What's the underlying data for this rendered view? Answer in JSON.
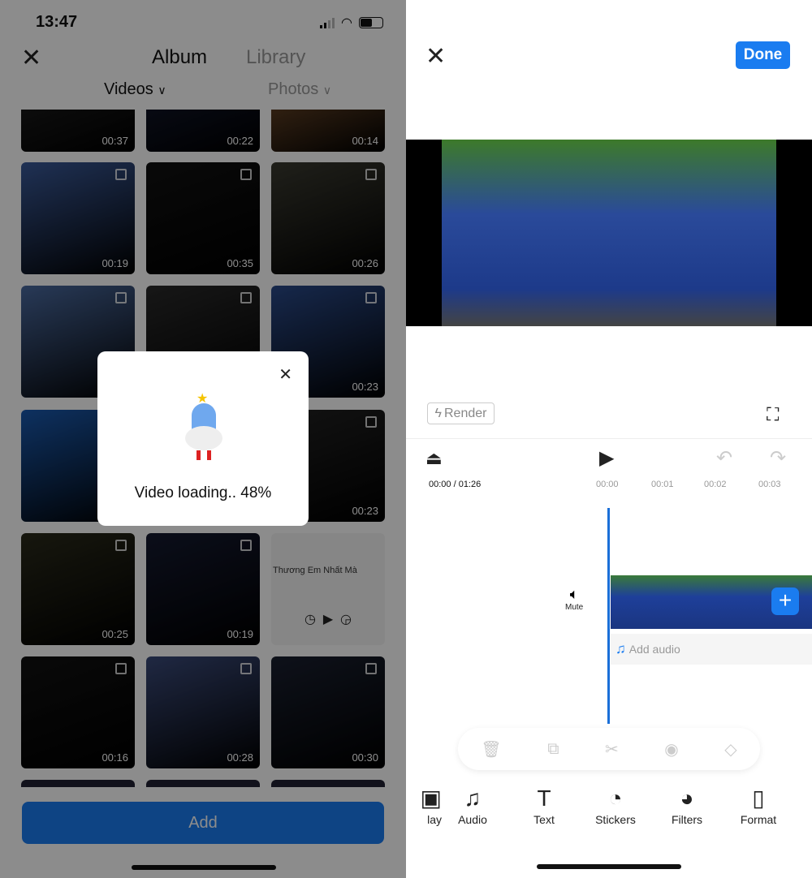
{
  "status_bar": {
    "time": "13:47"
  },
  "picker": {
    "tabs": [
      "Album",
      "Library"
    ],
    "filters": [
      "Videos",
      "Photos"
    ],
    "thumbnails": [
      {
        "duration": "00:37",
        "color": "#2a2a2a"
      },
      {
        "duration": "00:22",
        "color": "#1a2240"
      },
      {
        "duration": "00:14",
        "color": "#a06a3a"
      },
      {
        "duration": "00:19",
        "color": "#3a5a9a"
      },
      {
        "duration": "00:35",
        "color": "#111111"
      },
      {
        "duration": "00:26",
        "color": "#3a3a30"
      },
      {
        "duration": "",
        "color": "#4a6aa0"
      },
      {
        "duration": "",
        "color": "#2a2a2a"
      },
      {
        "duration": "00:23",
        "color": "#2a4a8a"
      },
      {
        "duration": "",
        "color": "#1a5ab0"
      },
      {
        "duration": "",
        "color": "#2a2a2a"
      },
      {
        "duration": "00:23",
        "color": "#222222"
      },
      {
        "duration": "00:25",
        "color": "#2a2a1a"
      },
      {
        "duration": "00:19",
        "color": "#151a30"
      },
      {
        "duration": "",
        "color": "#f4f4f4"
      },
      {
        "duration": "00:16",
        "color": "#111111"
      },
      {
        "duration": "00:28",
        "color": "#3a4a7a"
      },
      {
        "duration": "00:30",
        "color": "#1a2030"
      }
    ],
    "audio_card": {
      "title": "Thương Em Nhất Mà"
    },
    "add_label": "Add"
  },
  "loading_modal": {
    "text": "Video loading.. 48%",
    "progress_percent": 48
  },
  "editor": {
    "done_label": "Done",
    "render_label": "Render",
    "time_readout": "00:00 / 01:26",
    "ticks": [
      "00:00",
      "00:01",
      "00:02",
      "00:03"
    ],
    "mute_label": "Mute",
    "add_audio_label": "Add audio",
    "tools": [
      {
        "label": "lay",
        "icon": "overlay-icon"
      },
      {
        "label": "Audio",
        "icon": "music-note-icon"
      },
      {
        "label": "Text",
        "icon": "text-icon"
      },
      {
        "label": "Stickers",
        "icon": "sticker-icon"
      },
      {
        "label": "Filters",
        "icon": "palette-icon"
      },
      {
        "label": "Format",
        "icon": "format-icon"
      }
    ],
    "accent": "#1a7cf0"
  }
}
